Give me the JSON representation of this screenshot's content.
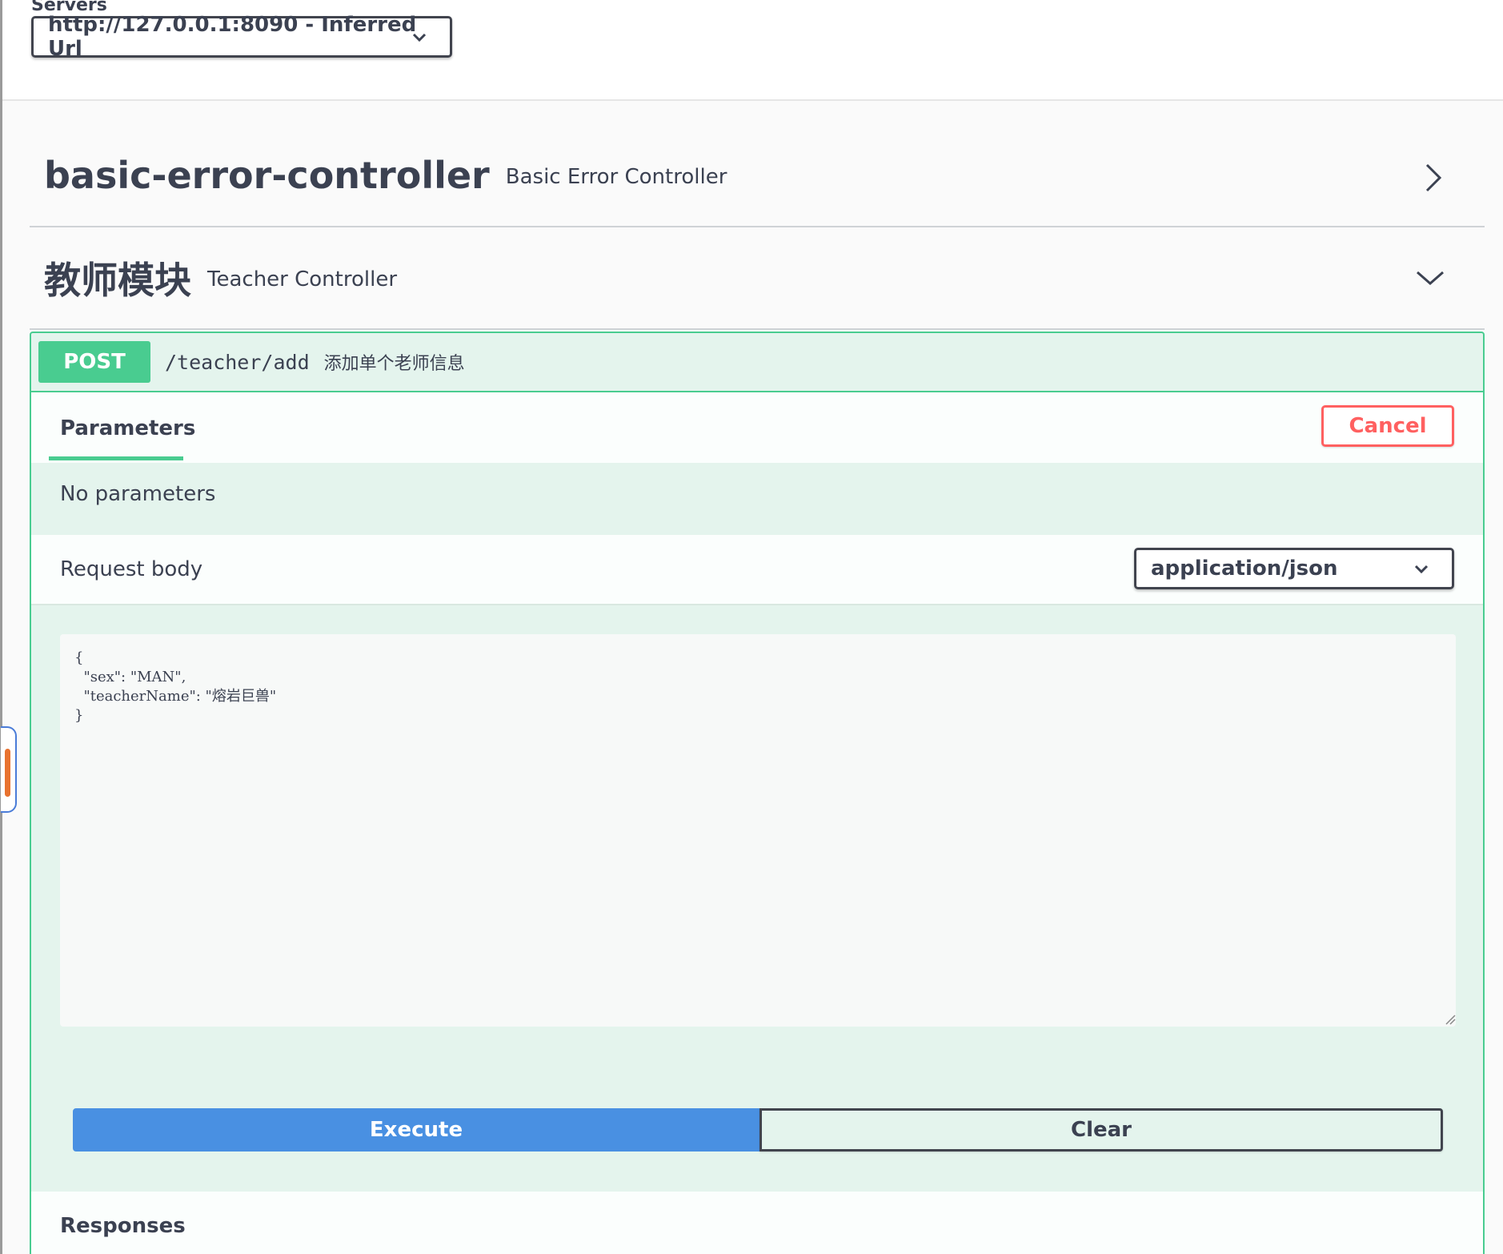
{
  "servers": {
    "label": "Servers",
    "selected": "http://127.0.0.1:8090 - Inferred Url"
  },
  "tags": [
    {
      "name": "basic-error-controller",
      "description": "Basic Error Controller",
      "state": "collapsed"
    },
    {
      "name": "教师模块",
      "description": "Teacher Controller",
      "state": "expanded"
    }
  ],
  "operation": {
    "method": "POST",
    "path": "/teacher/add",
    "summary": "添加单个老师信息",
    "tab_label": "Parameters",
    "cancel_label": "Cancel",
    "no_params_text": "No parameters",
    "request_body_label": "Request body",
    "content_type": "application/json",
    "body_text": "{\n  \"sex\": \"MAN\",\n  \"teacherName\": \"熔岩巨兽\"\n}",
    "execute_label": "Execute",
    "clear_label": "Clear",
    "responses_label": "Responses"
  },
  "colors": {
    "post": "#49cc90",
    "cancel": "#ff6060",
    "execute": "#4990e2",
    "text": "#3b4151"
  }
}
